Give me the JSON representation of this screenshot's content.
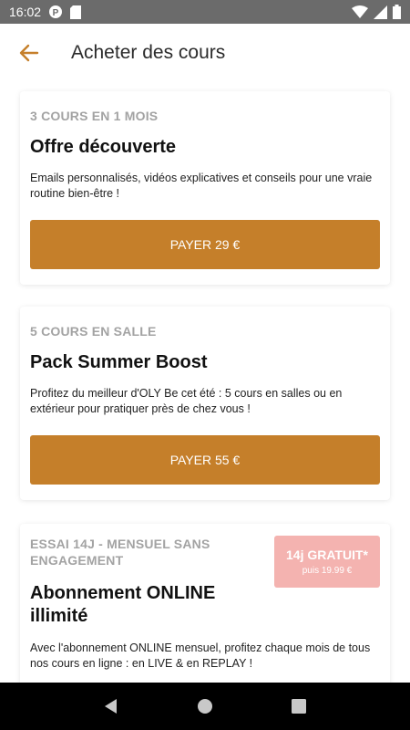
{
  "status_bar": {
    "time": "16:02"
  },
  "app_bar": {
    "title": "Acheter des cours"
  },
  "offers": [
    {
      "eyebrow": "3 COURS EN 1 MOIS",
      "title": "Offre découverte",
      "description": "Emails personnalisés, vidéos explicatives et conseils pour une vraie routine bien-être !",
      "button_label": "PAYER 29 €"
    },
    {
      "eyebrow": "5 COURS EN SALLE",
      "title": "Pack Summer Boost",
      "description": "Profitez du meilleur d'OLY Be cet été : 5 cours en salles ou en extérieur pour pratiquer près de chez vous !",
      "button_label": "PAYER 55 €"
    },
    {
      "eyebrow": "ESSAI 14J - MENSUEL SANS ENGAGEMENT",
      "title": "Abonnement ONLINE illimité",
      "description": "Avec l'abonnement ONLINE mensuel, profitez chaque mois de tous nos cours en ligne : en LIVE & en REPLAY !",
      "badge_main": "14j GRATUIT*",
      "badge_sub": "puis 19.99 €"
    }
  ],
  "colors": {
    "accent": "#c57f2a",
    "badge": "#f4b3b0",
    "status_bar": "#6b6b6b",
    "nav_bar": "#000000"
  },
  "icons": {
    "back": "arrow-left-icon",
    "wifi": "wifi-icon",
    "signal": "signal-icon",
    "battery": "battery-icon",
    "nav_back": "triangle-back-icon",
    "nav_home": "circle-home-icon",
    "nav_recents": "square-recents-icon"
  }
}
